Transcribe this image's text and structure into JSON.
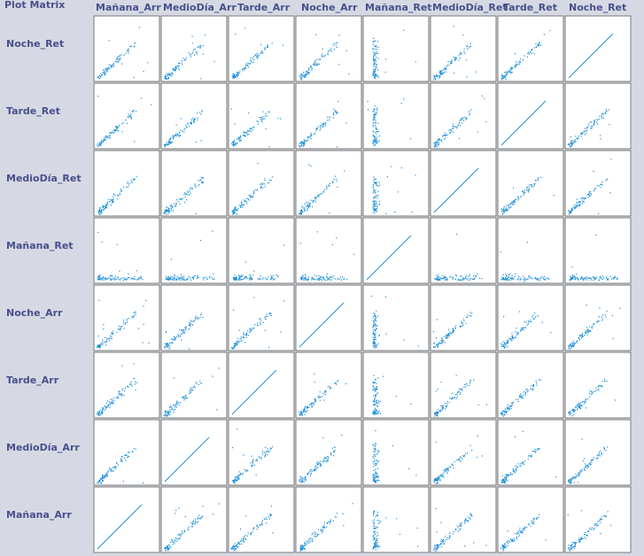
{
  "title": "Plot Matrix",
  "colors": {
    "background": "#d6d9e3",
    "panel": "#ffffff",
    "label": "#4a4f8c",
    "points": "#1f8fd8",
    "border": "#7a7a7a"
  },
  "chart_data": {
    "type": "scatter",
    "title": "Plot Matrix",
    "columns": [
      "Mañana_Arr",
      "MedioDía_Arr",
      "Tarde_Arr",
      "Noche_Arr",
      "Mañana_Ret",
      "MedioDía_Ret",
      "Tarde_Ret",
      "Noche_Ret"
    ],
    "rows": [
      "Noche_Ret",
      "Tarde_Ret",
      "MedioDía_Ret",
      "Mañana_Ret",
      "Noche_Arr",
      "Tarde_Arr",
      "MedioDía_Arr",
      "Mañana_Arr"
    ],
    "grid": false
  }
}
